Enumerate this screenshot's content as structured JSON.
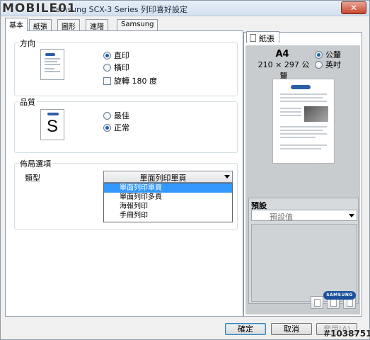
{
  "window": {
    "title": "Samsung SCX-3 Series 列印喜好設定",
    "close_label": "✕"
  },
  "watermark": "MOBILE01",
  "tabs": [
    {
      "label": "基本"
    },
    {
      "label": "紙張"
    },
    {
      "label": "圖形"
    },
    {
      "label": "進階"
    },
    {
      "label": "Samsung"
    }
  ],
  "orientation": {
    "title": "方向",
    "options": [
      {
        "label": "直印",
        "selected": true
      },
      {
        "label": "橫印",
        "selected": false
      }
    ],
    "rotate_label": "旋轉 180 度"
  },
  "quality": {
    "title": "品質",
    "icon_letter": "S",
    "options": [
      {
        "label": "最佳",
        "selected": false
      },
      {
        "label": "正常",
        "selected": true
      }
    ]
  },
  "layout": {
    "title": "佈局選項",
    "type_label": "類型",
    "selected": "單面列印單頁",
    "options": [
      "單面列印單頁",
      "單面列印多頁",
      "海報列印",
      "手冊列印"
    ]
  },
  "paper_panel": {
    "tab_label": "紙張",
    "paper_size": "A4",
    "paper_dims": "210 × 297 公釐",
    "units": [
      {
        "label": "公釐",
        "selected": true
      },
      {
        "label": "英吋",
        "selected": false
      }
    ]
  },
  "presets": {
    "title": "預設",
    "value": "預設值"
  },
  "brand": "SAMSUNG",
  "buttons": {
    "ok": "確定",
    "cancel": "取消",
    "apply": "套用(A)"
  },
  "image_tag": "#1038751"
}
